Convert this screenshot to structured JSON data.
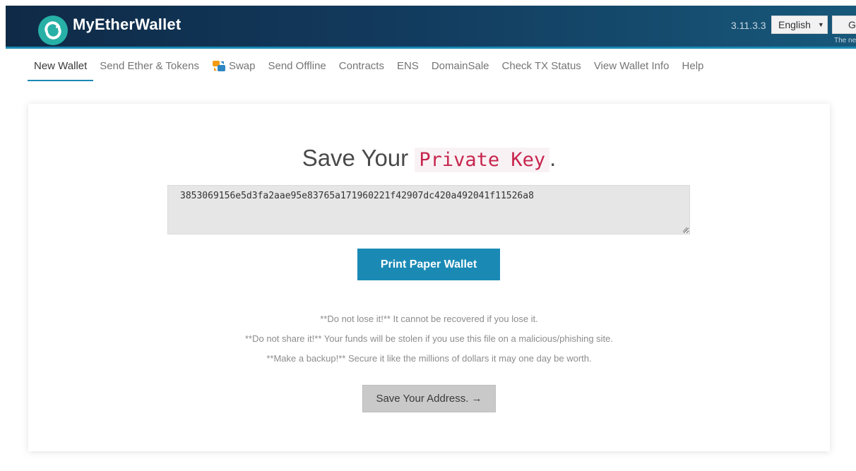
{
  "header": {
    "brand": "MyEtherWallet",
    "version": "3.11.3.3",
    "language": "English",
    "gas_label": "Gas Price",
    "gas_note": "The network is really full"
  },
  "nav": {
    "items": [
      {
        "label": "New Wallet",
        "active": true
      },
      {
        "label": "Send Ether & Tokens"
      },
      {
        "label": "Swap",
        "icon": "swap-icon"
      },
      {
        "label": "Send Offline"
      },
      {
        "label": "Contracts"
      },
      {
        "label": "ENS"
      },
      {
        "label": "DomainSale"
      },
      {
        "label": "Check TX Status"
      },
      {
        "label": "View Wallet Info"
      },
      {
        "label": "Help"
      }
    ]
  },
  "main": {
    "title_prefix": "Save Your",
    "title_key": "Private Key",
    "title_suffix": ".",
    "private_key": "3853069156e5d3fa2aae95e83765a171960221f42907dc420a492041f11526a8",
    "print_button": "Print Paper Wallet",
    "warnings": [
      "**Do not lose it!** It cannot be recovered if you lose it.",
      "**Do not share it!** Your funds will be stolen if you use this file on a malicious/phishing site.",
      "**Make a backup!** Secure it like the millions of dollars it may one day be worth."
    ],
    "next_button": "Save Your Address. →"
  },
  "colors": {
    "header_dark": "#0f2a47",
    "accent": "#1a8ab5",
    "key_red": "#c7254e"
  }
}
